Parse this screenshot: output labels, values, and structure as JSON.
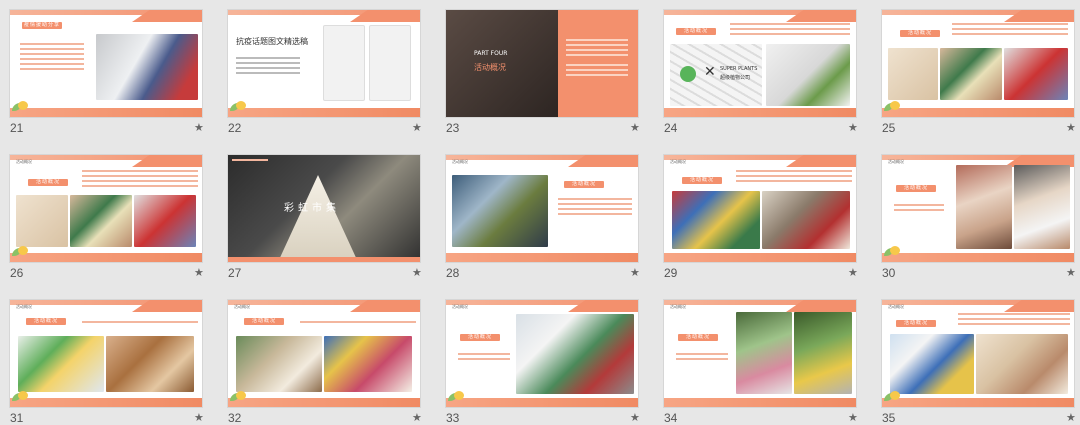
{
  "window": {
    "title": ""
  },
  "slides": [
    {
      "number": "21",
      "tag": "",
      "pill": "疫情援助分享",
      "text": ""
    },
    {
      "number": "22",
      "tag": "",
      "title": "抗疫话题图文精选稿",
      "text": ""
    },
    {
      "number": "23",
      "part": "PART FOUR",
      "title": "活动概况",
      "text": ""
    },
    {
      "number": "24",
      "pill": "活动概况",
      "logo_text": "SUPER PLANTS",
      "logo_sub": "超级植物公司",
      "text": ""
    },
    {
      "number": "25",
      "pill": "活动概况",
      "text": ""
    },
    {
      "number": "26",
      "tag": "活动概况",
      "pill": "活动概况",
      "text": ""
    },
    {
      "number": "27",
      "tag": "",
      "title": "彩虹市集"
    },
    {
      "number": "28",
      "tag": "活动概况",
      "pill": "活动概况",
      "text": ""
    },
    {
      "number": "29",
      "tag": "活动概况",
      "pill": "活动概况",
      "text": ""
    },
    {
      "number": "30",
      "tag": "活动概况",
      "pill": "活动概况",
      "text": ""
    },
    {
      "number": "31",
      "tag": "活动概况",
      "pill": "活动概况",
      "text": ""
    },
    {
      "number": "32",
      "tag": "活动概况",
      "pill": "活动概况",
      "text": ""
    },
    {
      "number": "33",
      "tag": "活动概况",
      "pill": "活动概况",
      "text": ""
    },
    {
      "number": "34",
      "tag": "活动概况",
      "pill": "活动概况",
      "text": ""
    },
    {
      "number": "35",
      "tag": "活动概况",
      "pill": "活动概况",
      "text": ""
    }
  ],
  "star_glyph": "★",
  "colors": {
    "accent": "#f3906d",
    "background": "#e7e7e7",
    "text_accent": "#e37a52"
  }
}
